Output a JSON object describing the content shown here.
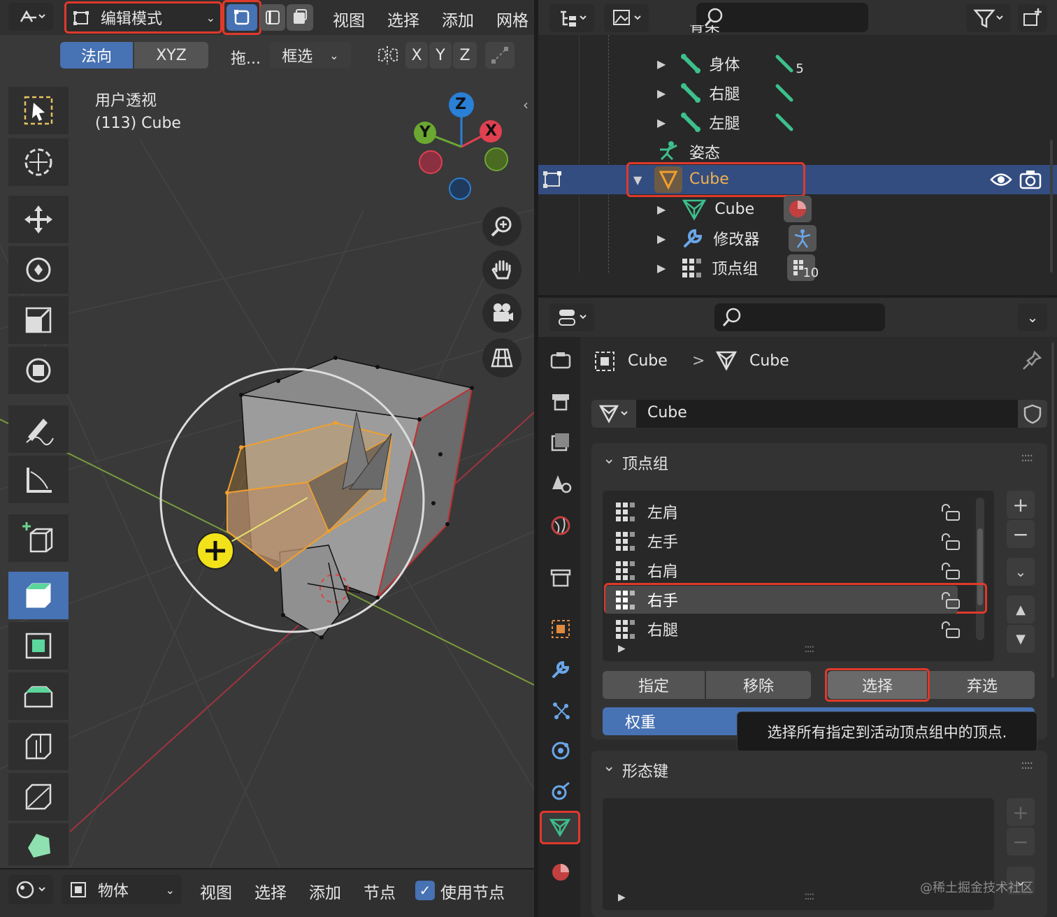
{
  "viewport": {
    "mode_label": "编辑模式",
    "menus": [
      "视图",
      "选择",
      "添加",
      "网格"
    ],
    "normal_label": "法向",
    "xyz_label": "XYZ",
    "drag_label": "拖...",
    "select_label": "框选",
    "axis_x": "X",
    "axis_y": "Y",
    "axis_z": "Z",
    "view_name": "用户透视",
    "object_info": "(113) Cube",
    "gizmo_z": "Z",
    "gizmo_y": "Y",
    "gizmo_x": "X"
  },
  "bottom_bar": {
    "mode_label": "物体",
    "menus": [
      "视图",
      "选择",
      "添加",
      "节点"
    ],
    "use_nodes_label": "使用节点",
    "use_nodes_checked": true
  },
  "outliner": {
    "partial_row": "骨架",
    "rows": [
      {
        "label": "身体",
        "badge": "5"
      },
      {
        "label": "右腿",
        "badge": ""
      },
      {
        "label": "左腿",
        "badge": ""
      },
      {
        "label": "姿态",
        "badge": ""
      },
      {
        "label": "Cube",
        "badge": ""
      },
      {
        "label": "Cube",
        "badge": ""
      },
      {
        "label": "修改器",
        "badge": ""
      },
      {
        "label": "顶点组",
        "badge": "10"
      }
    ]
  },
  "properties": {
    "breadcrumb_object": "Cube",
    "breadcrumb_sep": ">",
    "breadcrumb_mesh": "Cube",
    "mesh_name": "Cube",
    "vertex_groups_title": "顶点组",
    "vertex_groups": [
      "左肩",
      "左手",
      "右肩",
      "右手",
      "右腿"
    ],
    "active_group_index": 3,
    "assign_label": "指定",
    "remove_label": "移除",
    "select_label": "选择",
    "deselect_label": "弃选",
    "weight_label": "权重",
    "tooltip": "选择所有指定到活动顶点组中的顶点.",
    "shape_keys_title": "形态键"
  },
  "watermark": "@稀土掘金技术社区",
  "colors": {
    "accent_blue": "#4772b3",
    "highlight_red": "#e0392b",
    "selected_orange": "#f0a030",
    "bone_green": "#3dc08c"
  }
}
